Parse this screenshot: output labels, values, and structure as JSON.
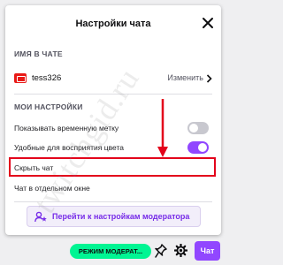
{
  "popup": {
    "title": "Настройки чата",
    "name_section": {
      "title": "ИМЯ В ЧАТЕ",
      "username": "tess326",
      "change_label": "Изменить"
    },
    "my_settings": {
      "title": "МОИ НАСТРОЙКИ",
      "items": [
        {
          "label": "Показывать временную метку",
          "toggle": "off"
        },
        {
          "label": "Удобные для восприятия цвета",
          "toggle": "on"
        },
        {
          "label": "Скрыть чат"
        },
        {
          "label": "Чат в отдельном окне"
        }
      ]
    },
    "moderator_button_label": "Перейти к настройкам модератора"
  },
  "bottom_bar": {
    "mode_badge": "РЕЖИМ МОДЕРАТ...",
    "chat_button": "Чат"
  },
  "watermark": "twitchgid.ru",
  "colors": {
    "accent": "#9147ff",
    "highlight": "#e3021b",
    "mode_badge": "#00f593"
  },
  "icons": [
    "close-icon",
    "chevron-right-icon",
    "user-star-icon",
    "pin-icon",
    "gear-icon",
    "arrow-down-icon"
  ]
}
